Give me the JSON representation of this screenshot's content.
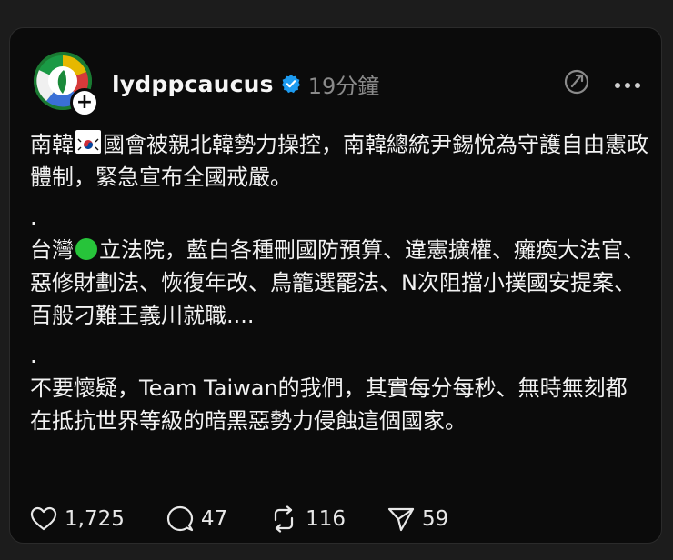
{
  "post": {
    "username": "lydppcaucus",
    "timestamp": "19分鐘",
    "avatar_follow_symbol": "+",
    "paragraphs": {
      "p1_a": "南韓",
      "p1_b": "國會被親北韓勢力操控，南韓總統尹錫悅為守護自由憲政體制，緊急宣布全國戒嚴。",
      "sep1": ".",
      "p2_a": "台灣",
      "p2_b": "立法院，藍白各種刪國防預算、違憲擴權、癱瘓大法官、惡修財劃法、恢復年改、鳥籠選罷法、N次阻擋小撲國安提案、百般刁難王義川就職....",
      "sep2": ".",
      "p3": "不要懷疑，Team Taiwan的我們，其實每分每秒、無時無刻都在抵抗世界等級的暗黑惡勢力侵蝕這個國家。"
    },
    "emoji": {
      "p1": "south-korea-flag",
      "p2": "green-circle"
    },
    "stats": {
      "likes": "1,725",
      "comments": "47",
      "reposts": "116",
      "shares": "59"
    },
    "icons": {
      "verified": "verified-badge-icon",
      "translate": "translate-icon",
      "more": "more-icon",
      "like": "heart-icon",
      "comment": "comment-icon",
      "repost": "repost-icon",
      "share": "share-icon"
    },
    "colors": {
      "background": "#0b0b0b",
      "text": "#f2f2f2",
      "muted": "#8a8a8a",
      "verified": "#1d9bf0",
      "green_dot": "#27c43a"
    }
  }
}
